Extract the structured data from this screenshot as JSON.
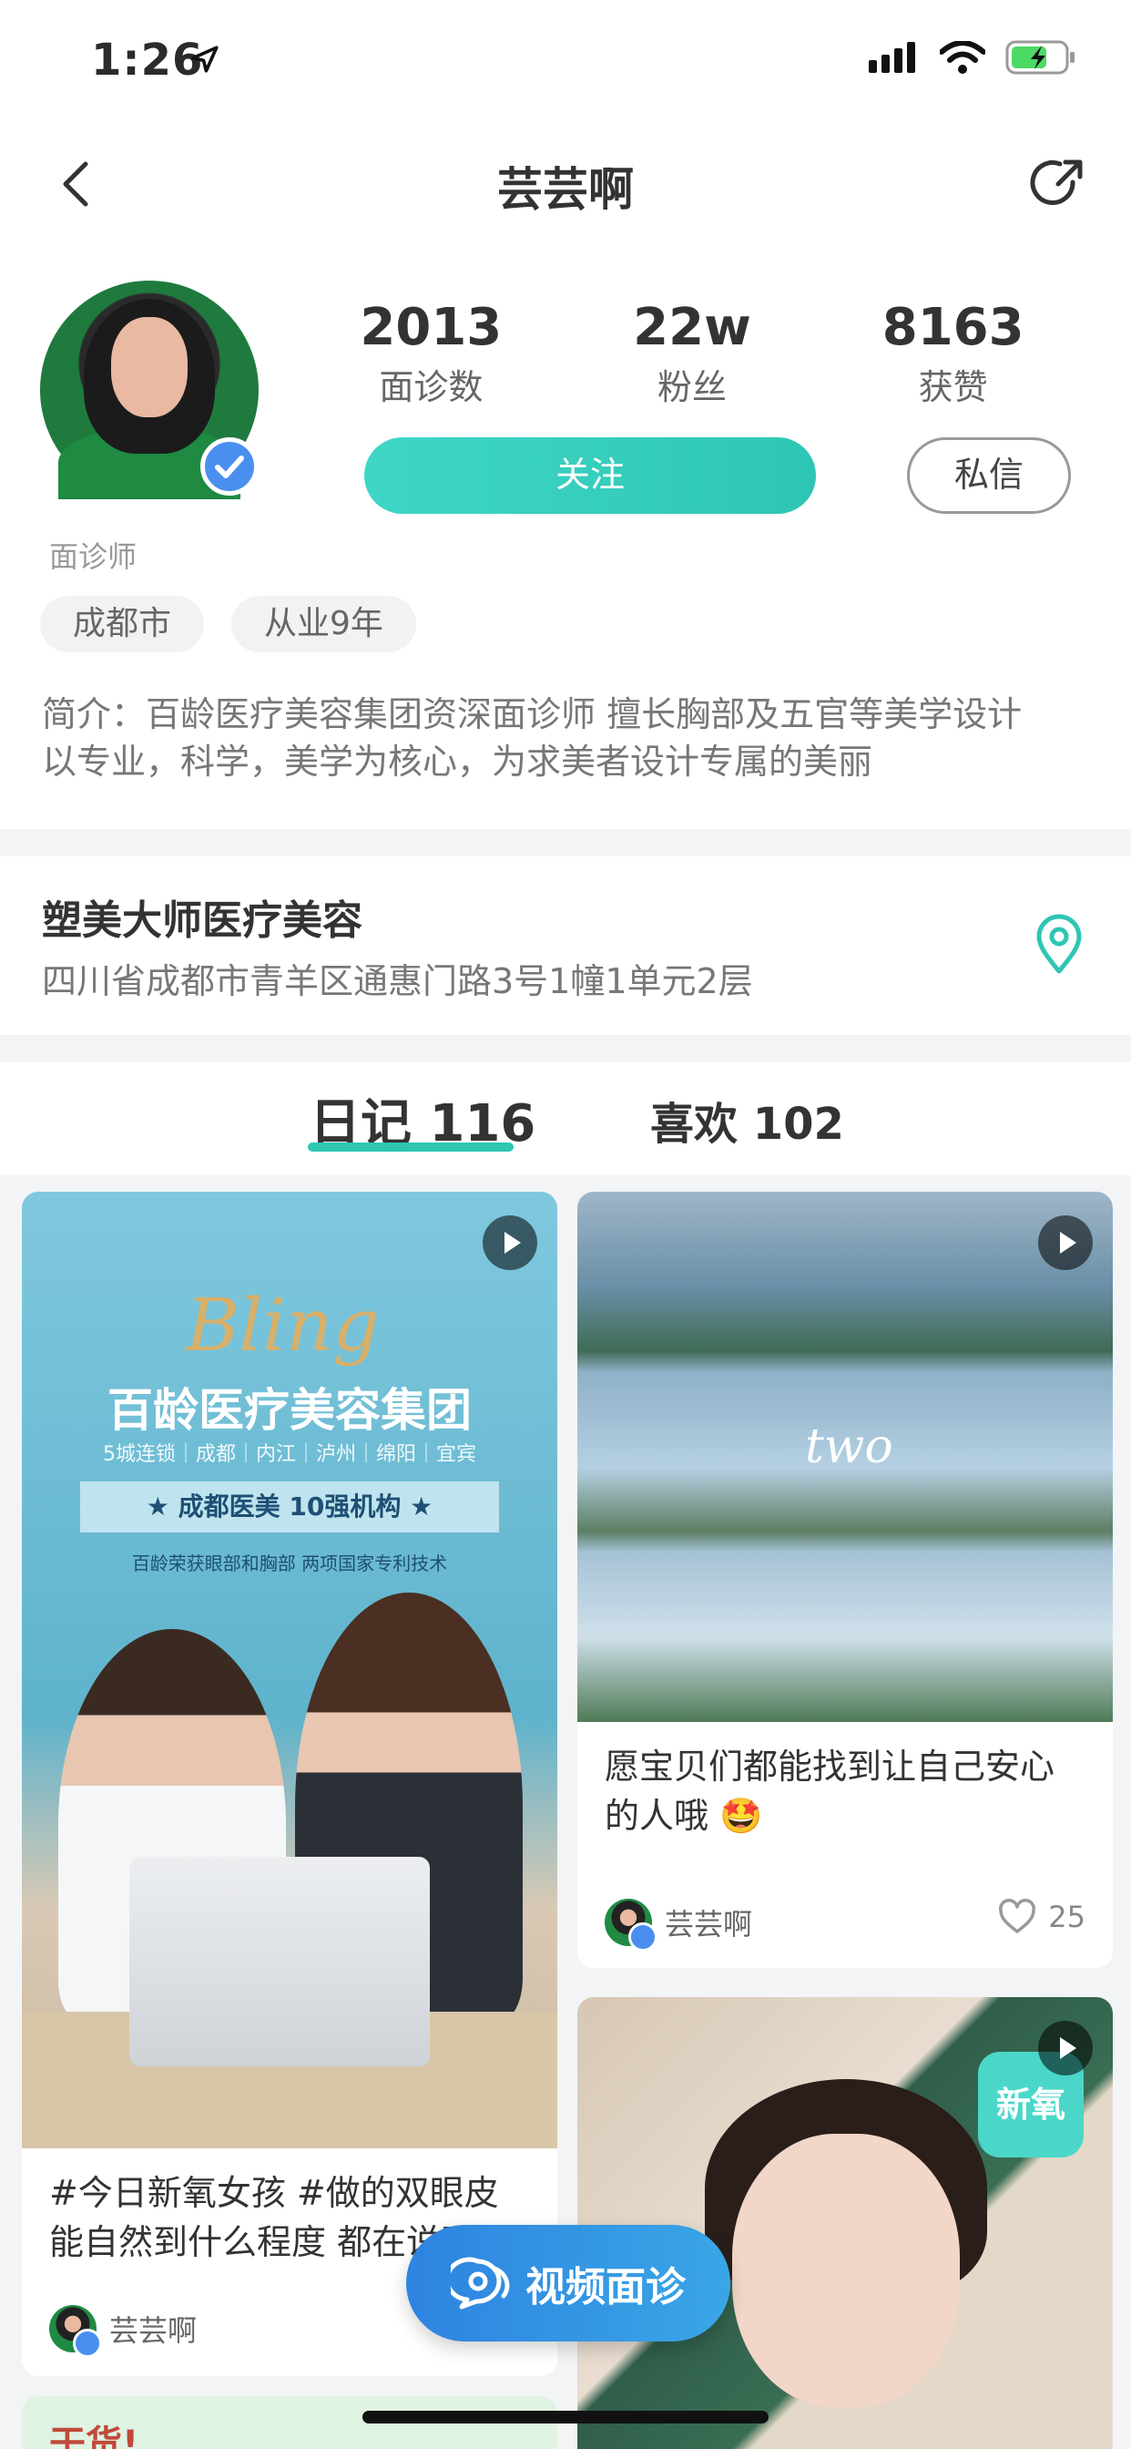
{
  "status_bar": {
    "time": "1:26"
  },
  "nav": {
    "title": "芸芸啊"
  },
  "profile": {
    "role": "面诊师",
    "stats": [
      {
        "value": "2013",
        "label": "面诊数"
      },
      {
        "value": "22w",
        "label": "粉丝"
      },
      {
        "value": "8163",
        "label": "获赞"
      }
    ],
    "follow_label": "关注",
    "message_label": "私信",
    "tags": [
      "成都市",
      "从业9年"
    ],
    "bio_line1": "简介：百龄医疗美容集团资深面诊师 擅长胸部及五官等美学设计",
    "bio_line2": "以专业，科学，美学为核心，为求美者设计专属的美丽"
  },
  "clinic": {
    "name": "塑美大师医疗美容",
    "address": "四川省成都市青羊区通惠门路3号1幢1单元2层"
  },
  "tabs": [
    {
      "label": "日记 116"
    },
    {
      "label": "喜欢 102"
    }
  ],
  "feed": {
    "card1": {
      "brand": "Bling",
      "headline": "百龄医疗美容集团",
      "subline": "5城连锁｜成都｜内江｜泸州｜绵阳｜宜宾",
      "ribbon": "★ 成都医美 10强机构 ★",
      "note": "百龄荣获眼部和胸部 两项国家专利技术",
      "title": "#今日新氧女孩 #做的双眼皮能自然到什么程度 都在说明",
      "author": "芸芸啊"
    },
    "card2": {
      "overlay_text": "two",
      "title": "愿宝贝们都能找到让自己安心的人哦 🤩",
      "author": "芸芸啊",
      "likes": "25"
    },
    "card3": {
      "badge": "新氧"
    },
    "card4": {
      "text": "干货!"
    }
  },
  "video_button": {
    "label": "视频面诊"
  },
  "colors": {
    "accent": "#2ec6b3",
    "blue": "#2e83e0",
    "verify": "#4a8ff0"
  }
}
